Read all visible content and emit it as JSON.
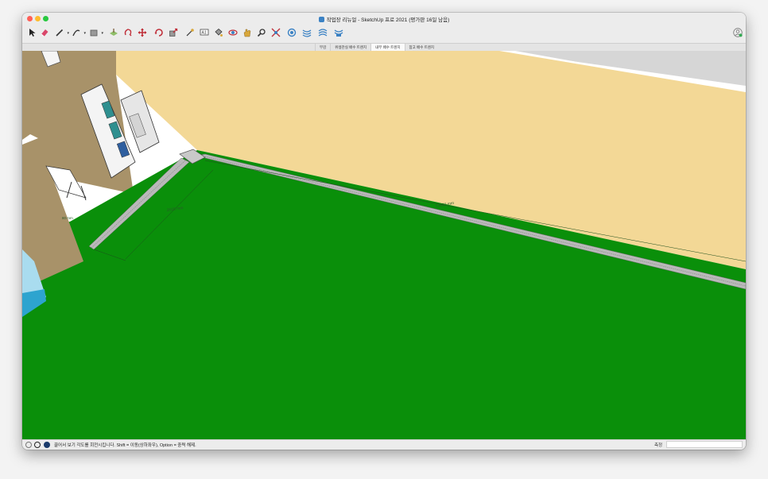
{
  "window": {
    "title": "작업장 리뉴얼 - SketchUp 프로 2021 (평가판 16일 남음)"
  },
  "toolbar": {
    "tools": [
      {
        "name": "select-tool",
        "icon": "arrow-cursor-icon",
        "color": "#222222"
      },
      {
        "name": "eraser-tool",
        "icon": "eraser-icon",
        "color": "#d9466a"
      },
      {
        "name": "line-tool",
        "icon": "pencil-line-icon",
        "color": "#333333",
        "dropdown": true
      },
      {
        "name": "arc-tool",
        "icon": "arc-icon",
        "color": "#333333",
        "dropdown": true
      },
      {
        "name": "shape-tool",
        "icon": "rectangle-icon",
        "color": "#555555",
        "dropdown": true
      },
      {
        "name": "push-pull-tool",
        "icon": "push-pull-icon",
        "color": "#7a5a3a"
      },
      {
        "name": "offset-tool",
        "icon": "offset-icon",
        "color": "#c0303a"
      },
      {
        "name": "move-tool",
        "icon": "move-icon",
        "color": "#c0303a"
      },
      {
        "name": "rotate-tool",
        "icon": "rotate-icon",
        "color": "#c0303a"
      },
      {
        "name": "scale-tool",
        "icon": "scale-icon",
        "color": "#c0303a"
      },
      {
        "name": "tape-measure-tool",
        "icon": "tape-measure-icon",
        "color": "#333333"
      },
      {
        "name": "text-tool",
        "icon": "text-icon",
        "color": "#333333"
      },
      {
        "name": "paint-bucket-tool",
        "icon": "paint-bucket-icon",
        "color": "#333333"
      },
      {
        "name": "orbit-tool",
        "icon": "orbit-icon",
        "color": "#c0303a"
      },
      {
        "name": "pan-tool",
        "icon": "pan-hand-icon",
        "color": "#d9a73a"
      },
      {
        "name": "zoom-tool",
        "icon": "zoom-icon",
        "color": "#333333"
      },
      {
        "name": "zoom-extents-tool",
        "icon": "zoom-extents-icon",
        "color": "#c0303a"
      },
      {
        "name": "3d-warehouse",
        "icon": "warehouse-icon",
        "color": "#3b82c4"
      },
      {
        "name": "extension-warehouse",
        "icon": "extension-icon",
        "color": "#3b82c4"
      },
      {
        "name": "layout-send",
        "icon": "layout-icon",
        "color": "#3b82c4"
      },
      {
        "name": "extension-manager",
        "icon": "extension-manager-icon",
        "color": "#3b82c4"
      }
    ]
  },
  "scene_tabs": [
    {
      "label": "부감",
      "active": false
    },
    {
      "label": "위생관실 배수 트렌치",
      "active": false
    },
    {
      "label": "내부 배수 트렌치",
      "active": true
    },
    {
      "label": "참고 배수 트렌치",
      "active": false
    }
  ],
  "viewport": {
    "dimension_labels": [
      "2620 mm",
      "13060 mm",
      "80 mm"
    ],
    "colors": {
      "floor": "#0a8f0a",
      "wall_right": "#f3d896",
      "wall_left": "#a89269",
      "trench": "#b9b9b9",
      "ceiling": "#d4d4d4"
    }
  },
  "statusbar": {
    "hint": "끌어서 보기 각도를 회전시킵니다. Shift = 이동(상하좌우), Option = 중력 해제.",
    "measure_label": "측정",
    "measure_value": ""
  }
}
